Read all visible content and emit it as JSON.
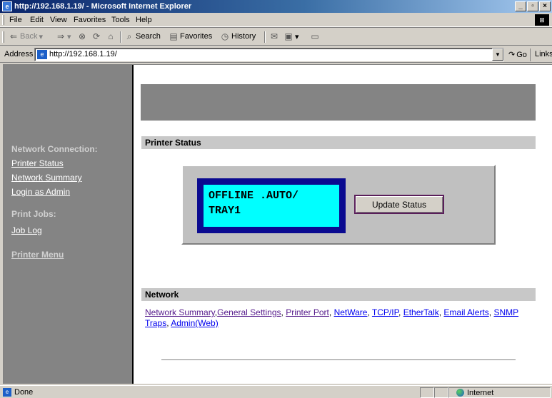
{
  "window": {
    "title": "http://192.168.1.19/ - Microsoft Internet Explorer",
    "title_url": "http://192.168.1.19/",
    "title_app": " - Microsoft Internet Explorer",
    "buttons": [
      "_",
      "▫",
      "×"
    ]
  },
  "menu": {
    "items": [
      "File",
      "Edit",
      "View",
      "Favorites",
      "Tools",
      "Help"
    ]
  },
  "toolbar": {
    "back": "Back",
    "search": "Search",
    "favorites": "Favorites",
    "history": "History"
  },
  "address": {
    "label": "Address",
    "value": "http://192.168.1.19/",
    "go": "Go",
    "links": "Links"
  },
  "sidebar": {
    "network_heading": "Network Connection:",
    "links": [
      "Printer Status",
      "Network Summary",
      "Login as Admin"
    ],
    "print_jobs_heading": "Print Jobs:",
    "job_log": "Job Log",
    "printer_menu": "Printer Menu"
  },
  "main": {
    "printer_status_title": "Printer Status",
    "lcd": {
      "line1": "OFFLINE .AUTO/",
      "line2": "TRAY1"
    },
    "update_button": "Update Status",
    "network_title": "Network",
    "network_links": [
      "Network Summary",
      "General Settings",
      "Printer Port",
      "NetWare",
      "TCP/IP",
      "EtherTalk",
      "Email Alerts",
      "SNMP Traps",
      "Admin(Web)"
    ]
  },
  "status": {
    "text": "Done",
    "zone": "Internet"
  },
  "colors": {
    "sidebar": "#848484",
    "lcd_bg": "#00ffff",
    "lcd_frame": "#0a0a90",
    "section_bar": "#c8c8c8"
  }
}
